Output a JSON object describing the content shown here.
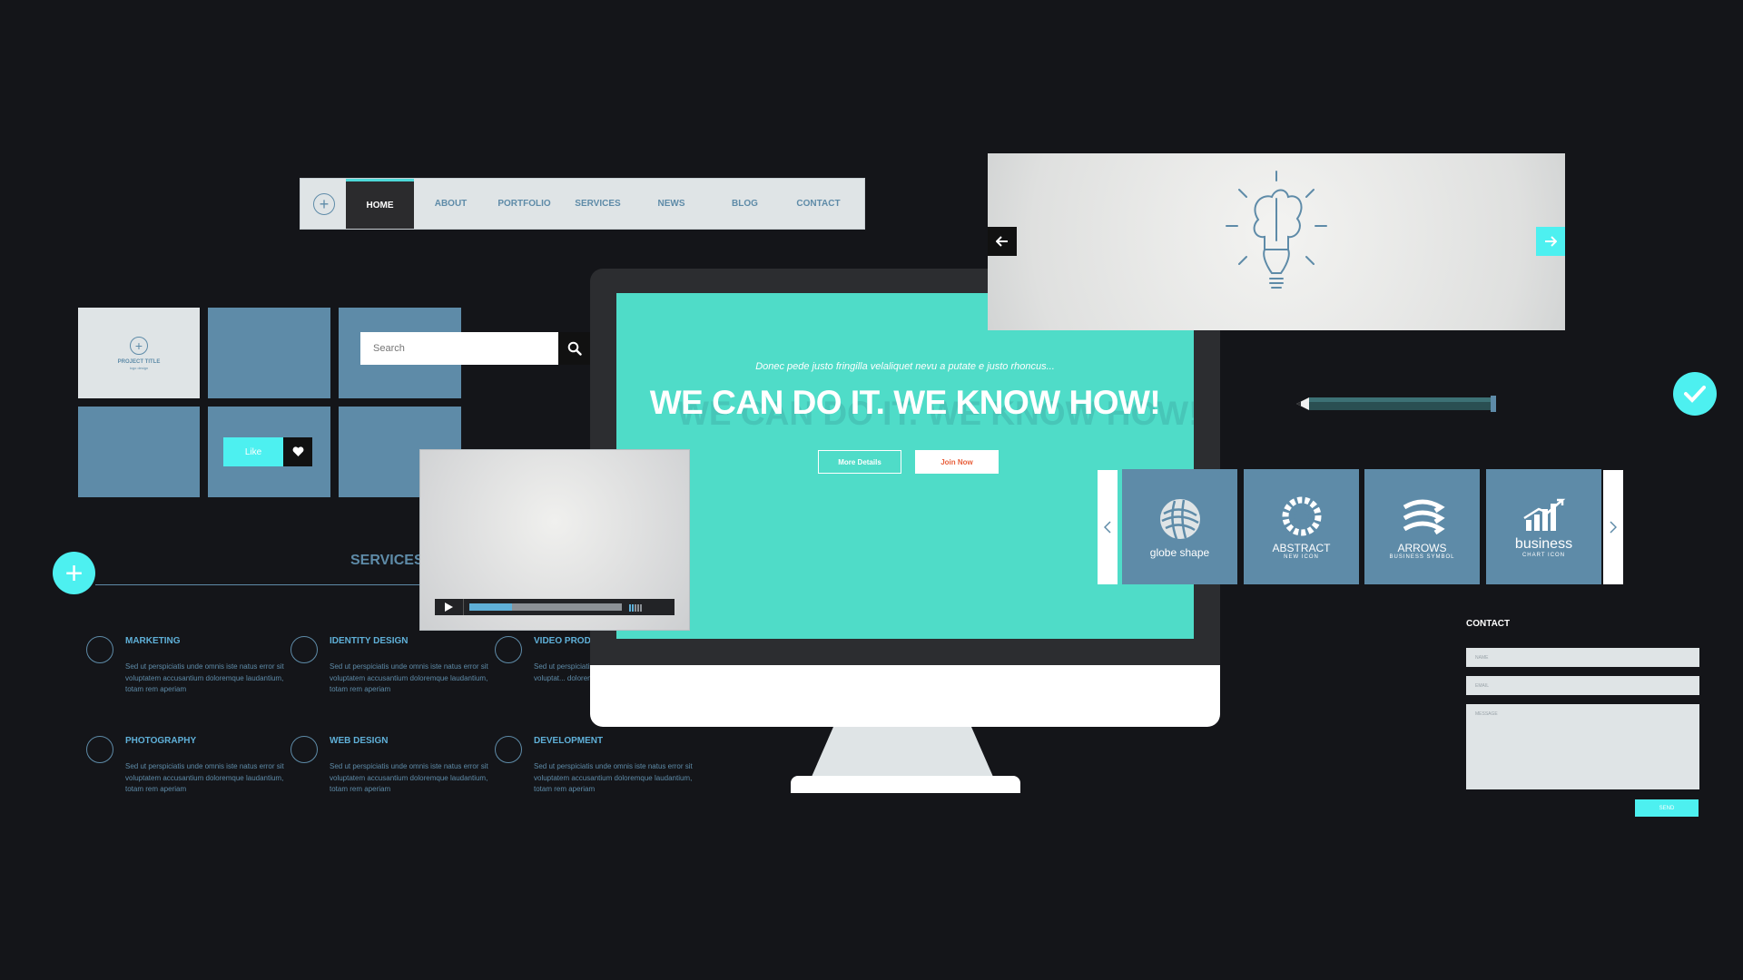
{
  "nav": {
    "items": [
      "HOME",
      "ABOUT",
      "PORTFOLIO",
      "SERVICES",
      "NEWS",
      "BLOG",
      "CONTACT"
    ],
    "active": "HOME"
  },
  "tiles": {
    "project_title": "PROJECT TITLE",
    "project_subtitle": "logo design"
  },
  "search": {
    "placeholder": "Search"
  },
  "like": {
    "label": "Like"
  },
  "services": {
    "title": "SERVICES",
    "items": [
      {
        "title": "MARKETING",
        "desc": "Sed ut perspiciatis unde omnis iste natus error sit voluptatem accusantium doloremque laudantium, totam rem aperiam",
        "icon": "megaphone-icon"
      },
      {
        "title": "IDENTITY DESIGN",
        "desc": "Sed ut perspiciatis unde omnis iste natus error sit voluptatem accusantium doloremque laudantium, totam rem aperiam",
        "icon": "lightbulb-icon"
      },
      {
        "title": "VIDEO PRODU",
        "desc": "Sed ut perspiciatis unde omnis iste natus error sit voluptat... doloremque laud...",
        "icon": "video-camera-icon"
      },
      {
        "title": "PHOTOGRAPHY",
        "desc": "Sed ut perspiciatis unde omnis iste natus error sit voluptatem accusantium doloremque laudantium, totam rem aperiam",
        "icon": "aperture-icon"
      },
      {
        "title": "WEB DESIGN",
        "desc": "Sed ut perspiciatis unde omnis iste natus error sit voluptatem accusantium doloremque laudantium, totam rem aperiam",
        "icon": "laptop-icon"
      },
      {
        "title": "DEVELOPMENT",
        "desc": "Sed ut perspiciatis unde omnis iste natus error sit voluptatem accusantium doloremque laudantium, totam rem aperiam",
        "icon": "globe-icon"
      }
    ]
  },
  "hero": {
    "subtitle": "Donec pede justo fringilla velaliquet nevu a putate e justo rhoncus...",
    "title": "WE CAN DO IT. WE KNOW HOW!",
    "btn_more": "More Details",
    "btn_join": "Join Now"
  },
  "video": {
    "progress": 0.28
  },
  "logos": [
    {
      "title": "globe shape",
      "sub": "",
      "icon": "globe-logo-icon"
    },
    {
      "title": "ABSTRACT",
      "sub": "NEW ICON",
      "icon": "abstract-logo-icon"
    },
    {
      "title": "ARROWS",
      "sub": "BUSINESS SYMBOL",
      "icon": "arrows-logo-icon"
    },
    {
      "title": "business",
      "sub": "CHART ICON",
      "icon": "chart-logo-icon"
    }
  ],
  "contact": {
    "title": "CONTACT",
    "name_placeholder": "NAME",
    "email_placeholder": "EMAIL",
    "message_placeholder": "MESSAGE",
    "send": "SEND"
  },
  "colors": {
    "background": "#141519",
    "accent": "#4df0f0",
    "tile": "#5e8ba8",
    "screen": "#4fdcc8",
    "join_text": "#e8603c"
  }
}
